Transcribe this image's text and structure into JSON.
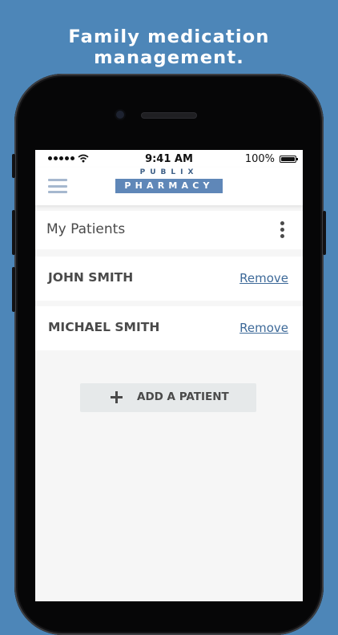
{
  "headline": "Family medication management.",
  "status_bar": {
    "time": "9:41 AM",
    "battery": "100%",
    "signal_icon": "signal-dots-icon",
    "wifi_icon": "wifi-icon",
    "battery_icon": "battery-icon"
  },
  "header": {
    "menu_icon": "hamburger-menu-icon",
    "logo_top": "PUBLIX",
    "logo_main": "PHARMACY"
  },
  "patients_panel": {
    "title": "My Patients",
    "more_icon": "more-vertical-icon",
    "patients": [
      {
        "name": "JOHN SMITH",
        "action": "Remove"
      },
      {
        "name": "MICHAEL SMITH",
        "action": "Remove"
      }
    ]
  },
  "add_patient": {
    "label": "ADD A PATIENT",
    "icon": "plus-icon"
  },
  "colors": {
    "background": "#4d86b8",
    "logo_blue": "#5f87b8",
    "link": "#3e6a99",
    "text": "#4a4a4a"
  }
}
